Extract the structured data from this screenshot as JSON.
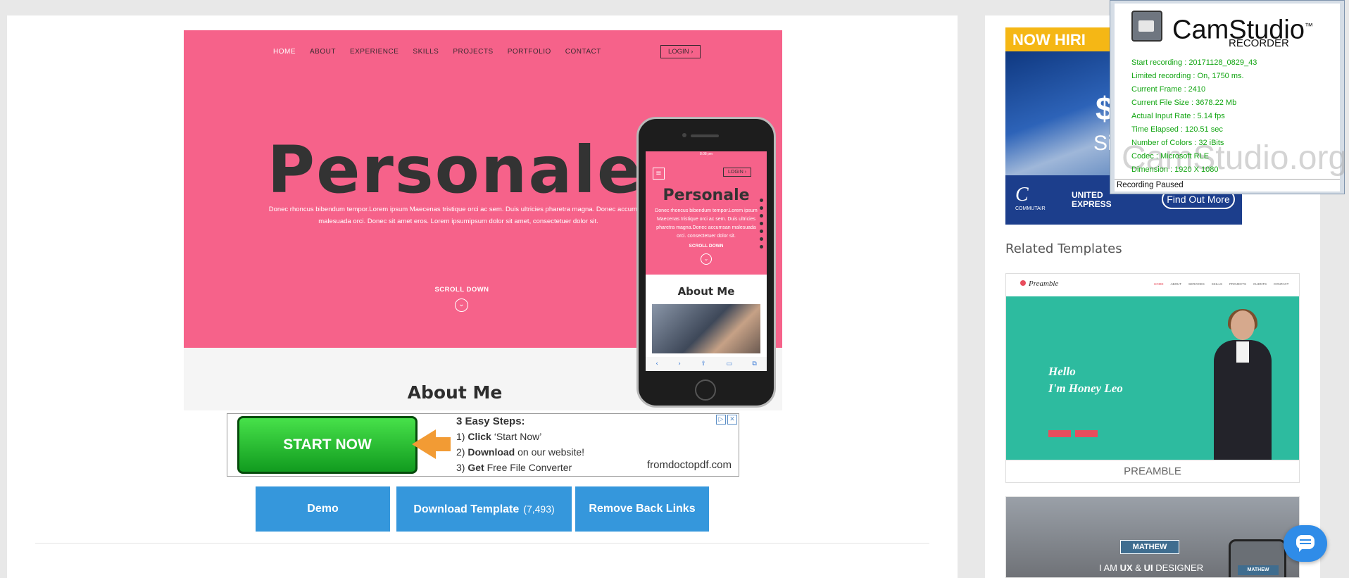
{
  "preview": {
    "nav": [
      "HOME",
      "ABOUT",
      "EXPERIENCE",
      "SKILLS",
      "PROJECTS",
      "PORTFOLIO",
      "CONTACT"
    ],
    "login": "LOGIN ›",
    "title": "Personale",
    "description": "Donec rhoncus bibendum tempor.Lorem ipsum Maecenas tristique orci ac sem. Duis ultricies pharetra magna. Donec accumsan malesuada orci. Donec sit amet eros. Lorem ipsumipsum dolor sit amet, consectetuer dolor sit.",
    "scroll_down": "SCROLL DOWN",
    "about_heading": "About Me",
    "colors": {
      "hero": "#f6628a"
    }
  },
  "phone": {
    "status": "8:08 pm",
    "login": "LOGIN ›",
    "title": "Personale",
    "description": "Donec rhoncus bibendum tempor.Lorem ipsum Maecenas tristique orci ac sem. Duis ultricies pharetra magna.Donec accumsan malesuada orci. consectetuer dolor sit.",
    "scroll_down": "SCROLL DOWN",
    "about_heading": "About Me"
  },
  "ad": {
    "button": "START NOW",
    "steps_title": "3 Easy Steps:",
    "step1_pre": "1) ",
    "step1_bold": "Click",
    "step1_post": " ‘Start Now’",
    "step2_pre": "2) ",
    "step2_bold": "Download",
    "step2_post": " on our website!",
    "step3_pre": "3) ",
    "step3_bold": "Get",
    "step3_post": " Free File Converter",
    "site": "fromdoctopdf.com"
  },
  "actions": {
    "demo": "Demo",
    "download": "Download Template",
    "download_count": "(7,493)",
    "remove_links": "Remove Back Links"
  },
  "sidebar": {
    "ad_heading": "NOW HIRI",
    "ad_dollar": "$",
    "ad_sign": "Sig",
    "ad_logo": "C",
    "ad_logo_text": "COMMUTAIR",
    "ad_united": "UNITED",
    "ad_express": "EXPRESS",
    "ad_cta": "Find Out More",
    "related_title": "Related Templates",
    "templates": [
      {
        "name": "PREAMBLE",
        "logo": "Preamble",
        "menu": [
          "HOME",
          "ABOUT",
          "SERVICES",
          "SKILLS",
          "PROJECTS",
          "CLIENTS",
          "CONTACT"
        ],
        "hello": "Hello",
        "name_line": "I'm Honey Leo"
      },
      {
        "badge": "MATHEW",
        "sub_pre": "I AM ",
        "sub_ux": "UX",
        "sub_mid": " & ",
        "sub_ui": "UI",
        "sub_post": " DESIGNER",
        "phone_badge": "MATHEW"
      }
    ]
  },
  "camstudio": {
    "title": "CamStudio",
    "tm": "™",
    "subtitle": "RECORDER",
    "lines": [
      "Start recording : 20171128_0829_43",
      "Limited recording : On, 1750 ms.",
      "Current Frame : 2410",
      "Current File Size : 3678.22 Mb",
      "Actual Input Rate : 5.14 fps",
      "Time Elapsed : 120.51 sec",
      "Number of Colors : 32 iBits",
      "Codec : Microsoft RLE",
      "Dimension : 1920 X 1080"
    ],
    "watermark": "CamStudio.org",
    "status": "Recording Paused"
  }
}
